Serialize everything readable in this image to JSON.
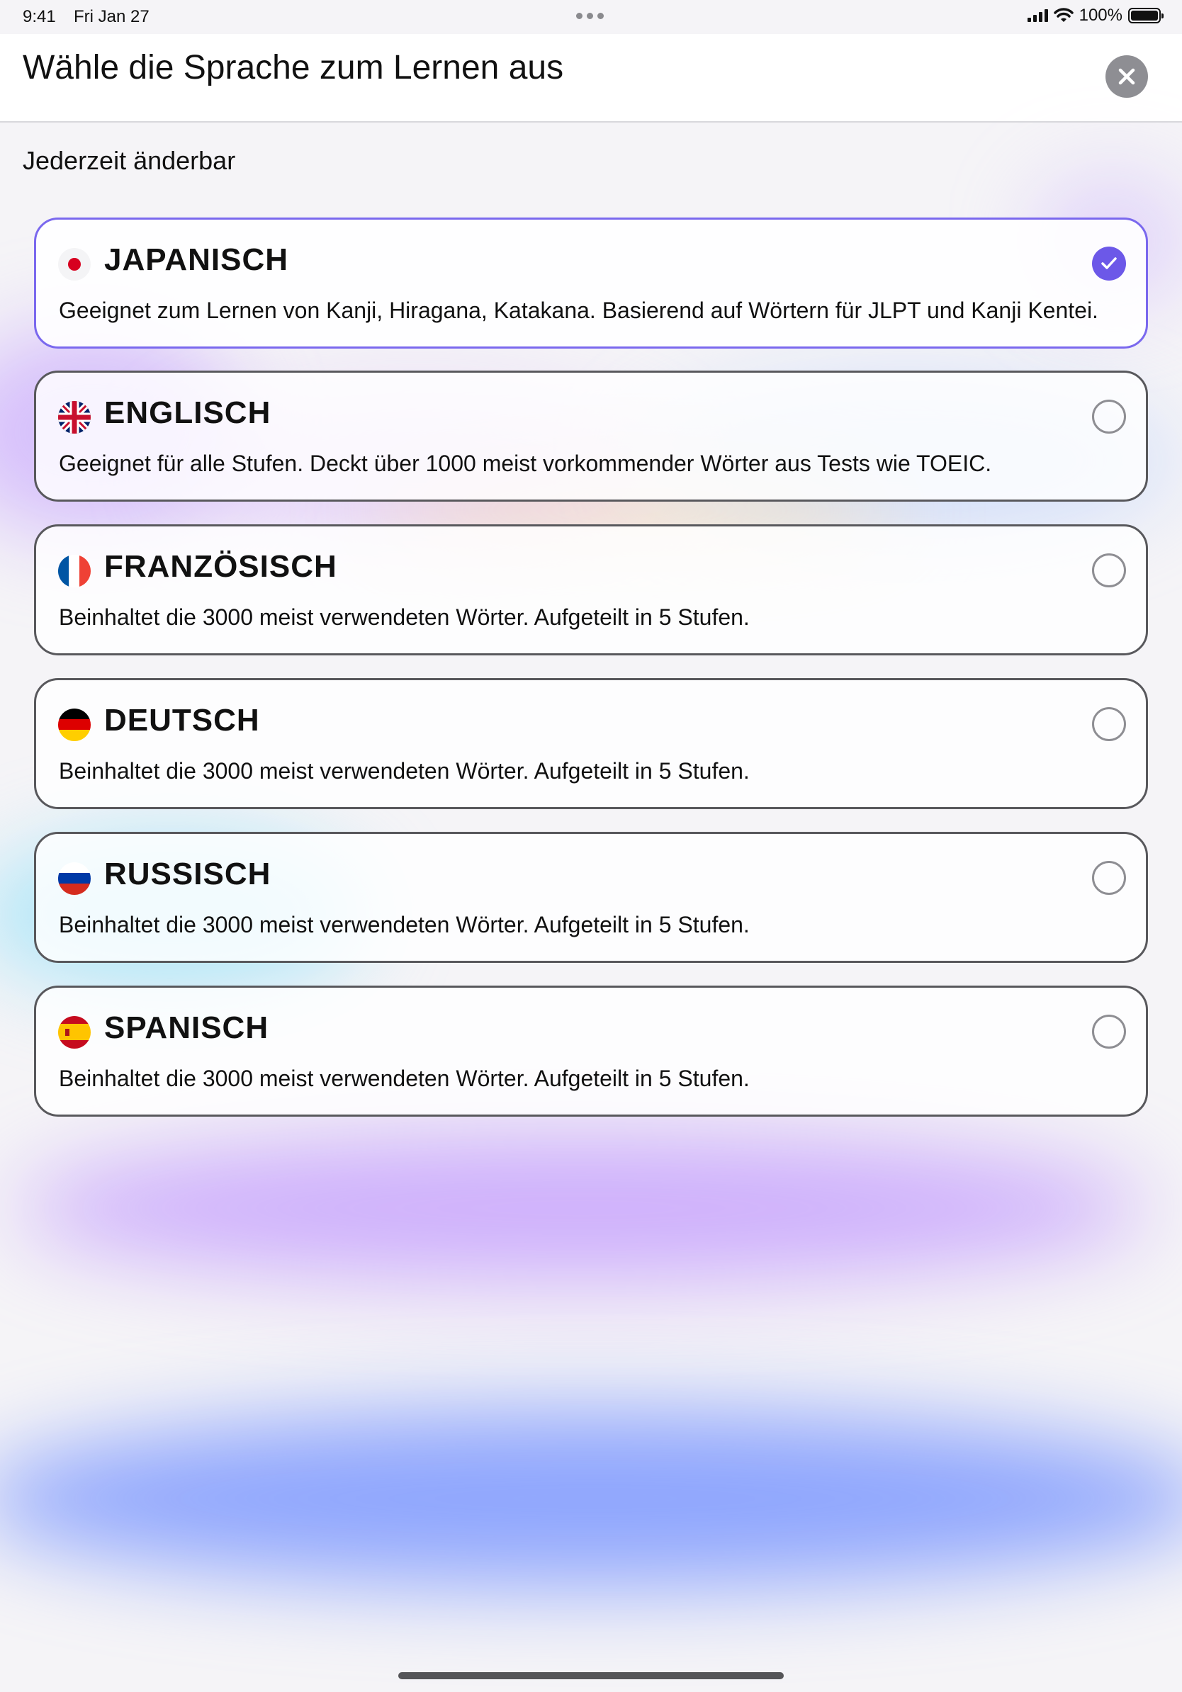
{
  "status_bar": {
    "time": "9:41",
    "date": "Fri Jan 27",
    "battery": "100%"
  },
  "header": {
    "title": "Wähle die Sprache zum Lernen aus",
    "close_icon": "close-icon"
  },
  "subtitle": "Jederzeit änderbar",
  "languages": [
    {
      "name": "JAPANISCH",
      "flag": "japan-flag-icon",
      "description": "Geeignet zum Lernen von Kanji, Hiragana, Katakana. Basierend auf Wörtern für JLPT und Kanji Kentei.",
      "selected": true
    },
    {
      "name": "ENGLISCH",
      "flag": "uk-flag-icon",
      "description": "Geeignet für alle Stufen. Deckt über 1000 meist vorkommender Wörter aus Tests wie TOEIC.",
      "selected": false
    },
    {
      "name": "FRANZÖSISCH",
      "flag": "france-flag-icon",
      "description": "Beinhaltet die 3000 meist verwendeten Wörter. Aufgeteilt in 5 Stufen.",
      "selected": false
    },
    {
      "name": "DEUTSCH",
      "flag": "germany-flag-icon",
      "description": "Beinhaltet die 3000 meist verwendeten Wörter. Aufgeteilt in 5 Stufen.",
      "selected": false
    },
    {
      "name": "RUSSISCH",
      "flag": "russia-flag-icon",
      "description": "Beinhaltet die 3000 meist verwendeten Wörter. Aufgeteilt in 5 Stufen.",
      "selected": false
    },
    {
      "name": "SPANISCH",
      "flag": "spain-flag-icon",
      "description": "Beinhaltet die 3000 meist verwendeten Wörter. Aufgeteilt in 5 Stufen.",
      "selected": false
    }
  ],
  "colors": {
    "accent": "#6c58e8",
    "selected_border": "#7a68ee",
    "card_border": "#58585c"
  }
}
